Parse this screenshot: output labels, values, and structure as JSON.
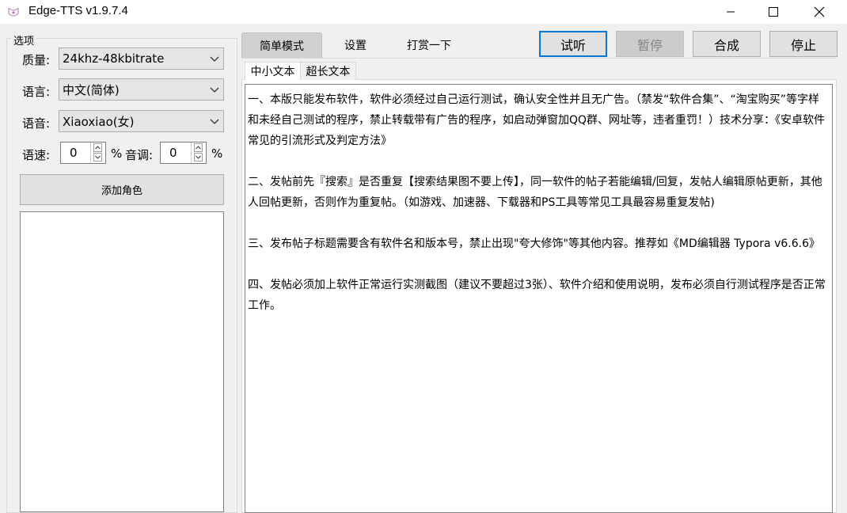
{
  "window": {
    "title": "Edge-TTS v1.9.7.4",
    "controls": [
      "minimize",
      "maximize",
      "close"
    ]
  },
  "options": {
    "group_title": "选项",
    "quality_label": "质量:",
    "quality_value": "24khz-48kbitrate",
    "language_label": "语言:",
    "language_value": "中文(简体)",
    "voice_label": "语音:",
    "voice_value": "Xiaoxiao(女)",
    "speed_label": "语速:",
    "speed_value": "0",
    "speed_unit": "%",
    "pitch_label": "音调:",
    "pitch_value": "0",
    "pitch_unit": "%",
    "add_role_label": "添加角色"
  },
  "tabs": [
    {
      "label": "简单模式",
      "selected": true
    },
    {
      "label": "设置",
      "selected": false
    },
    {
      "label": "打赏一下",
      "selected": false
    }
  ],
  "actions": {
    "listen": "试听",
    "pause": "暂停",
    "synthesize": "合成",
    "stop": "停止"
  },
  "inner_tabs": [
    {
      "label": "中小文本",
      "selected": true
    },
    {
      "label": "超长文本",
      "selected": false
    }
  ],
  "text_content": "一、本版只能发布软件，软件必须经过自己运行测试，确认安全性并且无广告。（禁发“软件合集”、“淘宝购买”等字样和未经自己测试的程序，禁止转载带有广告的程序，如启动弹窗加QQ群、网址等，违者重罚！）技术分享：《安卓软件常见的引流形式及判定方法》\n\n二、发帖前先『搜索』是否重复【搜索结果图不要上传】，同一软件的帖子若能编辑/回复，发帖人编辑原帖更新，其他人回帖更新，否则作为重复帖。（如游戏、加速器、下载器和PS工具等常见工具最容易重复发帖)\n\n三、发布帖子标题需要含有软件名和版本号，禁止出现\"夸大修饰\"等其他内容。推荐如《MD编辑器 Typora v6.6.6》\n\n四、发帖必须加上软件正常运行实测截图（建议不要超过3张）、软件介绍和使用说明，发布必须自行测试程序是否正常工作。",
  "colors": {
    "accent_border": "#0078d7",
    "disabled_text": "#838383"
  }
}
